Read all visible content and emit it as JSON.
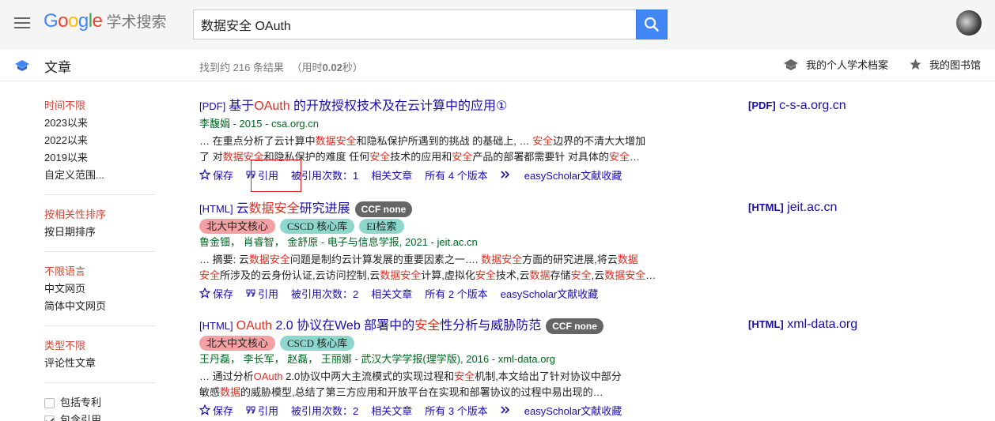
{
  "header": {
    "logo_google": [
      "G",
      "o",
      "o",
      "g",
      "l",
      "e"
    ],
    "logo_colors": [
      "#4285f4",
      "#ea4335",
      "#fbbc05",
      "#4285f4",
      "#34a853",
      "#ea4335"
    ],
    "logo_scholar": "学术搜索",
    "search_value": "数据安全 OAuth"
  },
  "subbar": {
    "section": "文章",
    "results_prefix": "找到约 216 条结果",
    "results_time_open": "（用时",
    "results_time": "0.02",
    "results_time_close": "秒）",
    "profile": "我的个人学术档案",
    "library": "我的图书馆"
  },
  "sidebar": {
    "time": [
      "时间不限",
      "2023以来",
      "2022以来",
      "2019以来",
      "自定义范围..."
    ],
    "sort": [
      "按相关性排序",
      "按日期排序"
    ],
    "lang": [
      "不限语言",
      "中文网页",
      "简体中文网页"
    ],
    "type": [
      "类型不限",
      "评论性文章"
    ],
    "include_patents": "包括专利",
    "include_citations": "包含引用"
  },
  "actions": {
    "save": "保存",
    "cite": "引用",
    "related": "相关文章",
    "easyscholar": "easyScholar文献收藏"
  },
  "results": [
    {
      "tag": "[PDF]",
      "title_parts": [
        "基于",
        "OAuth",
        " 的开放授权技术及在云计算中的应用①"
      ],
      "authors": "李馥娟 - 2015 - csa.org.cn",
      "snippet1_parts": [
        "… 在重点分析了云计算中",
        "数据安全",
        "和隐私保护所遇到的挑战 的基础上, … ",
        "安全",
        "边界的不清大大增加"
      ],
      "snippet2_parts": [
        "了 对",
        "数据安全",
        "和隐私保护的难度 任何",
        "安全",
        "技术的应用和",
        "安全",
        "产品的部署都需要针 对具体的",
        "安全",
        "…"
      ],
      "cited": "被引用次数：1",
      "versions": "所有 4 个版本",
      "side_tag": "[PDF]",
      "side_domain": "c-s-a.org.cn"
    },
    {
      "tag": "[HTML]",
      "title_parts": [
        "云",
        "数据安全",
        "研究进展"
      ],
      "ccf": "CCF none",
      "badges": [
        "北大中文核心",
        "CSCD 核心库",
        "EI检索"
      ],
      "authors": "鲁金钿， 肖睿智， 金舒原 - 电子与信息学报, 2021 - jeit.ac.cn",
      "snippet1_parts": [
        "… 摘要: 云",
        "数据安全",
        "问题是制约云计算发展的重要因素之一…. ",
        "数据安全",
        "方面的研究进展,将云",
        "数据"
      ],
      "snippet2_parts": [
        "安全",
        "所涉及的云身份认证,云访问控制,云",
        "数据安全",
        "计算,虚拟化",
        "安全",
        "技术,云",
        "数据",
        "存储",
        "安全",
        ",云",
        "数据安全",
        "…"
      ],
      "cited": "被引用次数：2",
      "versions": "所有 2 个版本",
      "side_tag": "[HTML]",
      "side_domain": "jeit.ac.cn"
    },
    {
      "tag": "[HTML]",
      "title_parts": [
        "OAuth",
        " 2.0 协议在Web 部署中的",
        "安全",
        "性分析与威胁防范"
      ],
      "ccf": "CCF none",
      "badges": [
        "北大中文核心",
        "CSCD 核心库"
      ],
      "authors": "王丹磊， 李长军， 赵磊， 王丽娜 - 武汉大学学报(理学版), 2016 - xml-data.org",
      "snippet1_parts": [
        "… 通过分析",
        "OAuth",
        " 2.0协议中两大主流模式的实现过程和",
        "安全",
        "机制,本文给出了针对协议中部分"
      ],
      "snippet2_parts": [
        "敏感",
        "数据",
        "的威胁模型,总结了第三方应用和开放平台在实现和部署协议的过程中易出现的…"
      ],
      "cited": "被引用次数：2",
      "versions": "所有 3 个版本",
      "side_tag": "[HTML]",
      "side_domain": "xml-data.org"
    }
  ]
}
